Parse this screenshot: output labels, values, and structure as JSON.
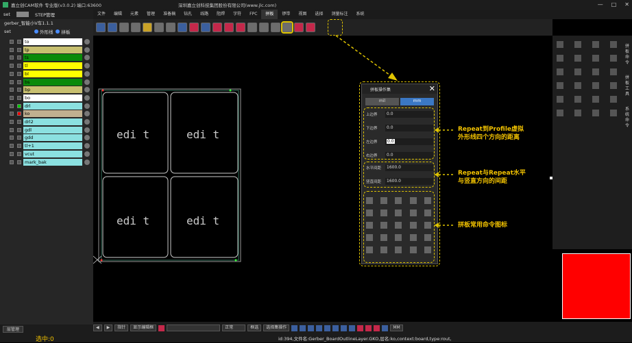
{
  "window": {
    "title": "嘉立创CAM软件 专业版(v3.0.2) 端口:63600",
    "company": "深圳嘉立创科技集团股份有限公司(www.jlc.com)",
    "controls": [
      "—",
      "□",
      "✕"
    ]
  },
  "menu": [
    "文件",
    "编辑",
    "元素",
    "管理",
    "准备稿",
    "钻孔",
    "线路",
    "阻焊",
    "字符",
    "FPC",
    "拼板",
    "锣带",
    "视图",
    "选择",
    "测量标注",
    "系统"
  ],
  "menu_active_index": 10,
  "left": {
    "tabs": [
      "set",
      "STEP管理"
    ],
    "job": "gerber_智能小V车1.1.1",
    "set_label": "set",
    "outline_label": "外形线",
    "panel_label": "拼板",
    "layers": [
      {
        "name": "to",
        "color": "#ffffff"
      },
      {
        "name": "tp",
        "color": "#c8c070"
      },
      {
        "name": "ts",
        "color": "#0a8a0a"
      },
      {
        "name": "tl",
        "color": "#ffff00"
      },
      {
        "name": "bl",
        "color": "#ffff00"
      },
      {
        "name": "bs",
        "color": "#0a8a0a"
      },
      {
        "name": "bp",
        "color": "#c8c070"
      },
      {
        "name": "bo",
        "color": "#ffffff"
      },
      {
        "name": "drl",
        "color": "#8be0e0"
      },
      {
        "name": "ko",
        "color": "#c0b090"
      },
      {
        "name": "drl2",
        "color": "#8be0e0"
      },
      {
        "name": "gdl",
        "color": "#8be0e0"
      },
      {
        "name": "gdd",
        "color": "#8be0e0"
      },
      {
        "name": "tl+1",
        "color": "#8be0e0"
      },
      {
        "name": "vcut",
        "color": "#8be0e0"
      },
      {
        "name": "mark_bak",
        "color": "#8be0e0"
      }
    ],
    "layer_manage_button": "层管理",
    "selected_count": "选中:0"
  },
  "canvas": {
    "board_text": "edi t"
  },
  "panel": {
    "title": "拼板操作集",
    "unit_mil": "mil",
    "unit_mm": "mm",
    "fields": [
      {
        "label": "上边界",
        "value": "0.0"
      },
      {
        "label": "下边界",
        "value": "0.0"
      },
      {
        "label": "左边界",
        "value": "0.0"
      },
      {
        "label": "右边界",
        "value": "0.0"
      }
    ],
    "spacing": [
      {
        "label": "水平间距",
        "value": "1600.0"
      },
      {
        "label": "竖直间距",
        "value": "1600.0"
      }
    ]
  },
  "annotations": {
    "a1_line1": "Repeat到Profile虚拟",
    "a1_line2": "外形线四个方向的距离",
    "a2_line1": "Repeat与Repeat水平",
    "a2_line2": "与竖直方向的间距",
    "a3": "拼板常用命令图标"
  },
  "right_vertical_tabs": [
    "拼板命令",
    "拼板工具",
    "系统命令"
  ],
  "status": {
    "zoom_mode": "指针",
    "display_btn": "显示编辑框",
    "combo": "正常",
    "select_btn": "框选",
    "select_all_btn": "选择集操作",
    "unit": "MM",
    "info": "id:394,文件名:Gerber_BoardOutlineLayer.GKO,层名:ko,context:board,type:rout,"
  }
}
